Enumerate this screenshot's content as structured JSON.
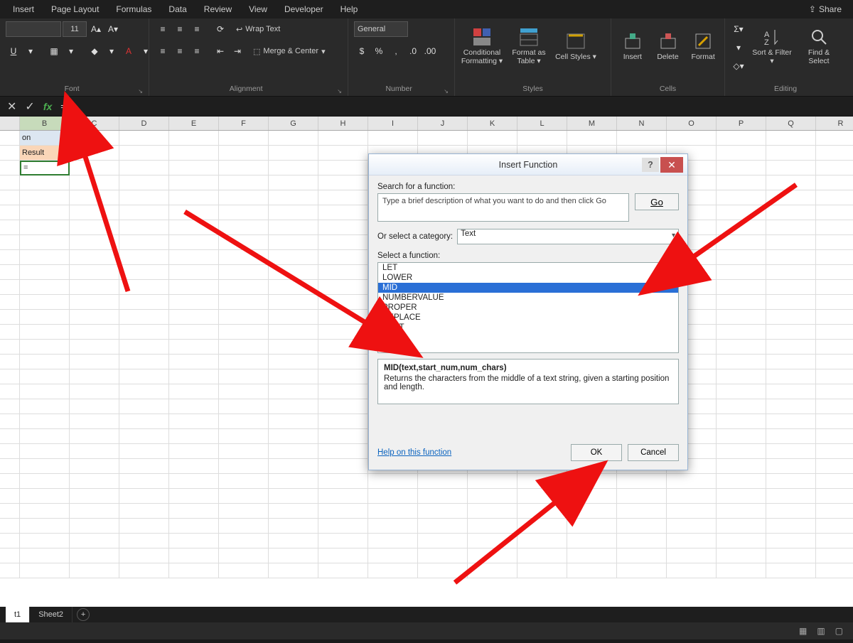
{
  "ribbon": {
    "tabs": [
      "Insert",
      "Page Layout",
      "Formulas",
      "Data",
      "Review",
      "View",
      "Developer",
      "Help"
    ],
    "share": "Share",
    "font": {
      "name": "",
      "size": "11",
      "increaseA": "A▴",
      "decreaseA": "A▾",
      "label": "Font"
    },
    "alignment": {
      "wrap": "Wrap Text",
      "merge": "Merge & Center",
      "label": "Alignment"
    },
    "number": {
      "format": "General",
      "label": "Number"
    },
    "styles": {
      "cond": "Conditional Formatting ▾",
      "table": "Format as Table ▾",
      "cell": "Cell Styles ▾",
      "label": "Styles"
    },
    "cells": {
      "insert": "Insert",
      "delete": "Delete",
      "format": "Format",
      "label": "Cells"
    },
    "editing": {
      "sort": "Sort & Filter ▾",
      "find": "Find & Select",
      "label": "Editing"
    }
  },
  "formula_bar": {
    "fx": "fx",
    "value": "="
  },
  "columns": [
    "",
    "B",
    "C",
    "D",
    "E",
    "F",
    "G",
    "H",
    "I",
    "J",
    "K",
    "L",
    "M",
    "N",
    "O",
    "P",
    "Q",
    "R"
  ],
  "cells": {
    "A1": "on",
    "B2": "Result",
    "A3": "="
  },
  "dialog": {
    "title": "Insert Function",
    "search_label": "Search for a function:",
    "search_placeholder": "Type a brief description of what you want to do and then click Go",
    "go": "Go",
    "category_label": "Or select a category:",
    "category_value": "Text",
    "list_label": "Select a function:",
    "functions": [
      "LET",
      "LOWER",
      "MID",
      "NUMBERVALUE",
      "PROPER",
      "REPLACE",
      "REPT"
    ],
    "selected": "MID",
    "signature": "MID(text,start_num,num_chars)",
    "description": "Returns the characters from the middle of a text string, given a starting position and length.",
    "help_link": "Help on this function",
    "ok": "OK",
    "cancel": "Cancel"
  },
  "sheets": {
    "s1": "t1",
    "s2": "Sheet2",
    "plus": "+"
  },
  "status_icons": [
    "▦",
    "▥",
    "▢"
  ]
}
